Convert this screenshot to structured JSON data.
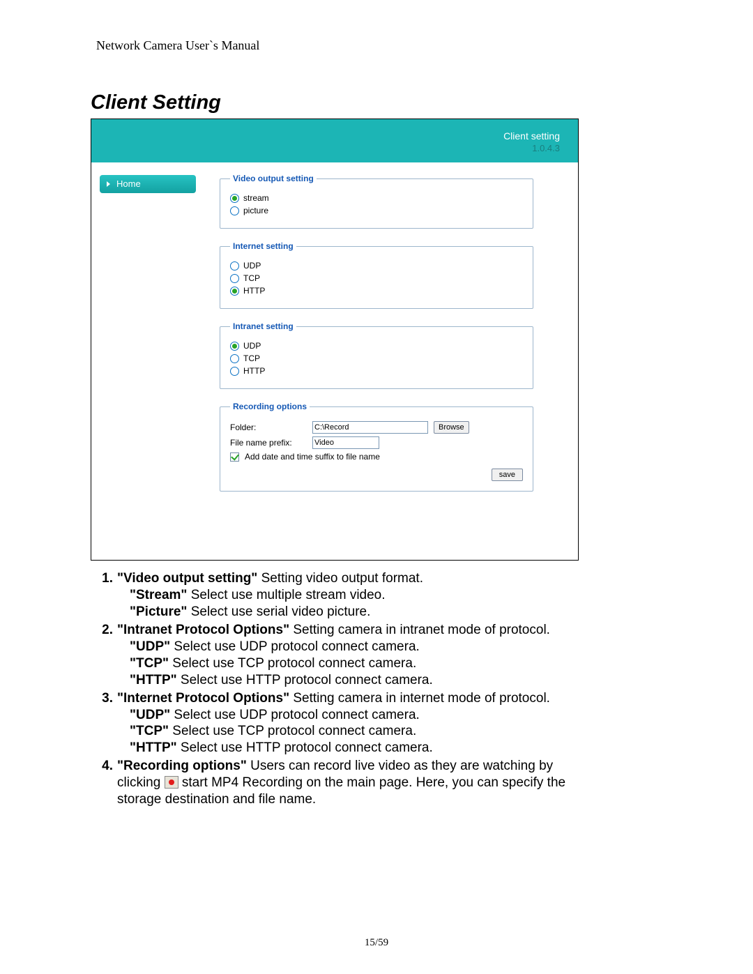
{
  "doc_header": "Network Camera User`s Manual",
  "section_heading": "Client Setting",
  "footer": "15/59",
  "banner": {
    "title": "Client setting",
    "version": "1.0.4.3"
  },
  "sidebar": {
    "home": "Home"
  },
  "groups": {
    "video": {
      "legend": "Video output setting",
      "options": [
        {
          "label": "stream",
          "checked": true
        },
        {
          "label": "picture",
          "checked": false
        }
      ]
    },
    "internet": {
      "legend": "Internet setting",
      "options": [
        {
          "label": "UDP",
          "checked": false
        },
        {
          "label": "TCP",
          "checked": false
        },
        {
          "label": "HTTP",
          "checked": true
        }
      ]
    },
    "intranet": {
      "legend": "Intranet setting",
      "options": [
        {
          "label": "UDP",
          "checked": true
        },
        {
          "label": "TCP",
          "checked": false
        },
        {
          "label": "HTTP",
          "checked": false
        }
      ]
    },
    "recording": {
      "legend": "Recording options",
      "folder_label": "Folder:",
      "folder_value": "C:\\Record",
      "browse": "Browse",
      "prefix_label": "File name prefix:",
      "prefix_value": "Video",
      "suffix_label": "Add date and time suffix to file name",
      "save": "save"
    }
  },
  "desc": {
    "i1_num": "1.",
    "i1_b": "\"Video output setting\"",
    "i1_t": " Setting video output format.",
    "i1_s1b": "\"Stream\"",
    "i1_s1t": " Select use multiple stream video.",
    "i1_s2b": "\"Picture\"",
    "i1_s2t": " Select use serial video picture.",
    "i2_num": "2.",
    "i2_b": "\"Intranet Protocol Options\"",
    "i2_t": " Setting camera in intranet mode of protocol.",
    "i2_s1b": "\"UDP\"",
    "i2_s1t": " Select use UDP protocol connect camera.",
    "i2_s2b": "\"TCP\"",
    "i2_s2t": " Select use TCP protocol connect camera.",
    "i2_s3b": "\"HTTP\"",
    "i2_s3t": " Select use HTTP protocol connect camera.",
    "i3_num": "3.",
    "i3_b": "\"Internet Protocol Options\"",
    "i3_t": " Setting camera in internet mode of protocol.",
    "i3_s1b": "\"UDP\"",
    "i3_s1t": " Select use UDP protocol connect camera.",
    "i3_s2b": "\"TCP\"",
    "i3_s2t": " Select use TCP protocol connect camera.",
    "i3_s3b": "\"HTTP\"",
    "i3_s3t": " Select use HTTP protocol connect camera.",
    "i4_num": "4.",
    "i4_b": "\"Recording options\"",
    "i4_t": " Users can record live video as they are watching by",
    "i4_line2a": "clicking ",
    "i4_line2b": " start MP4 Recording on the main page. Here, you can specify the",
    "i4_line3": "storage destination and file name."
  }
}
